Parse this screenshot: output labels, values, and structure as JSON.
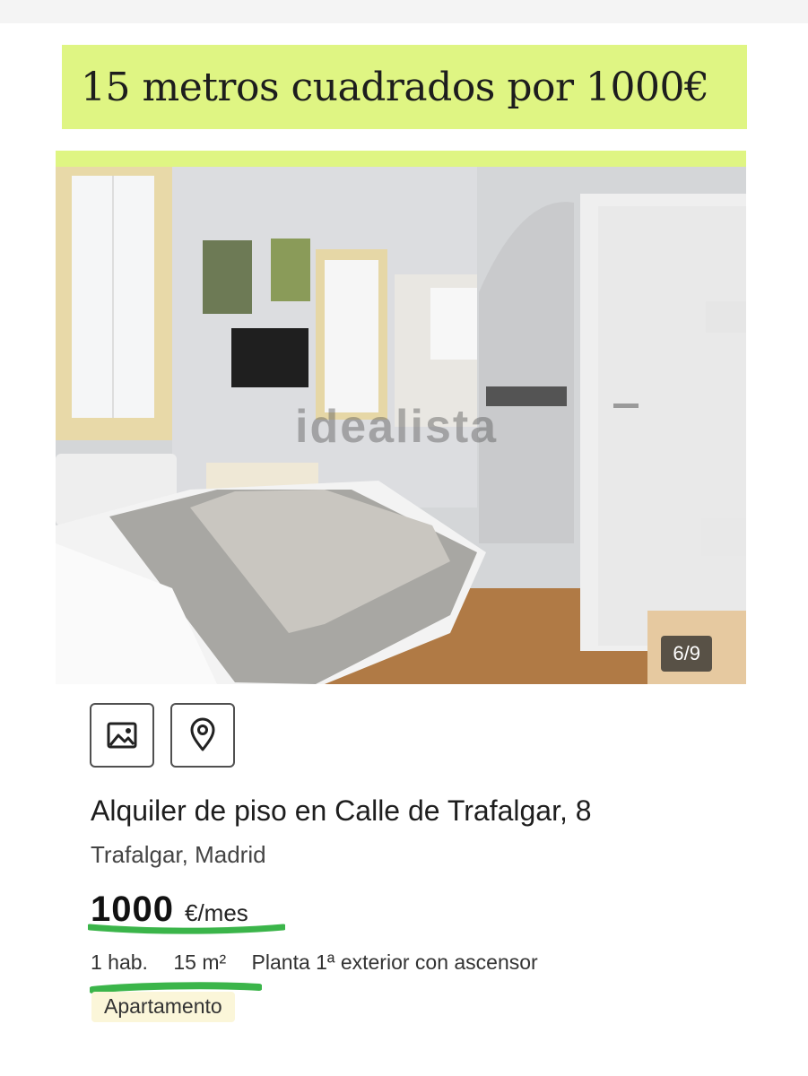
{
  "headline": "15 metros cuadrados por 1000€",
  "gallery": {
    "watermark": "idealista",
    "counter": "6/9"
  },
  "actions": [
    {
      "icon": "image-icon"
    },
    {
      "icon": "map-pin-icon"
    }
  ],
  "listing": {
    "title": "Alquiler de piso en Calle de Trafalgar, 8",
    "location": "Trafalgar, Madrid",
    "price": "1000",
    "price_unit": "€/mes",
    "features": [
      "1 hab.",
      "15 m²",
      "Planta 1ª exterior con ascensor"
    ],
    "type_tag": "Apartamento"
  },
  "colors": {
    "highlight": "#dff583",
    "marker": "#3bb54a",
    "tag_bg": "#fbf6d9"
  }
}
